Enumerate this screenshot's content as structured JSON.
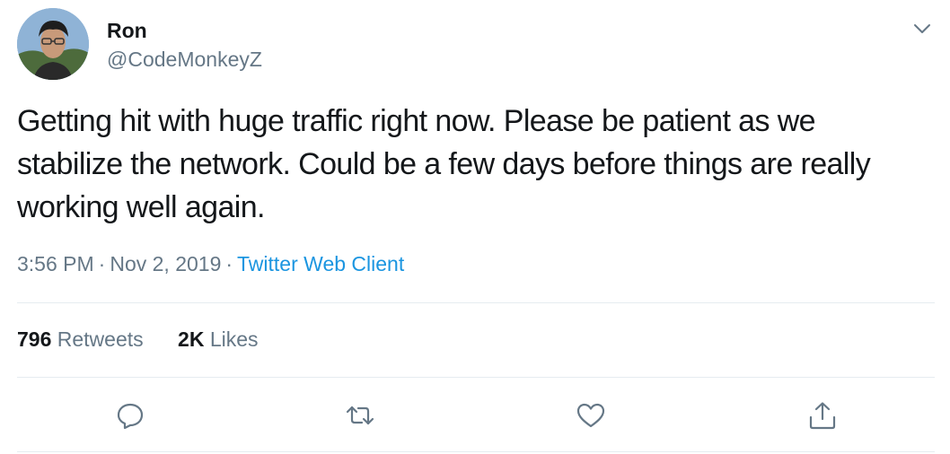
{
  "tweet": {
    "name": "Ron",
    "handle": "@CodeMonkeyZ",
    "text": "Getting hit with huge traffic right now. Please be patient as we stabilize the network. Could be a few days before things are really working well again.",
    "time": "3:56 PM",
    "date": "Nov 2, 2019",
    "separator": "·",
    "source": "Twitter Web Client"
  },
  "stats": {
    "retweets_count": "796",
    "retweets_label": "Retweets",
    "likes_count": "2K",
    "likes_label": "Likes"
  },
  "icons": {
    "menu": "chevron-down-icon",
    "reply": "reply-icon",
    "retweet": "retweet-icon",
    "like": "heart-icon",
    "share": "share-icon"
  },
  "colors": {
    "text": "#14171a",
    "secondary": "#657786",
    "link": "#1b95e0",
    "divider": "#e6ecf0"
  }
}
